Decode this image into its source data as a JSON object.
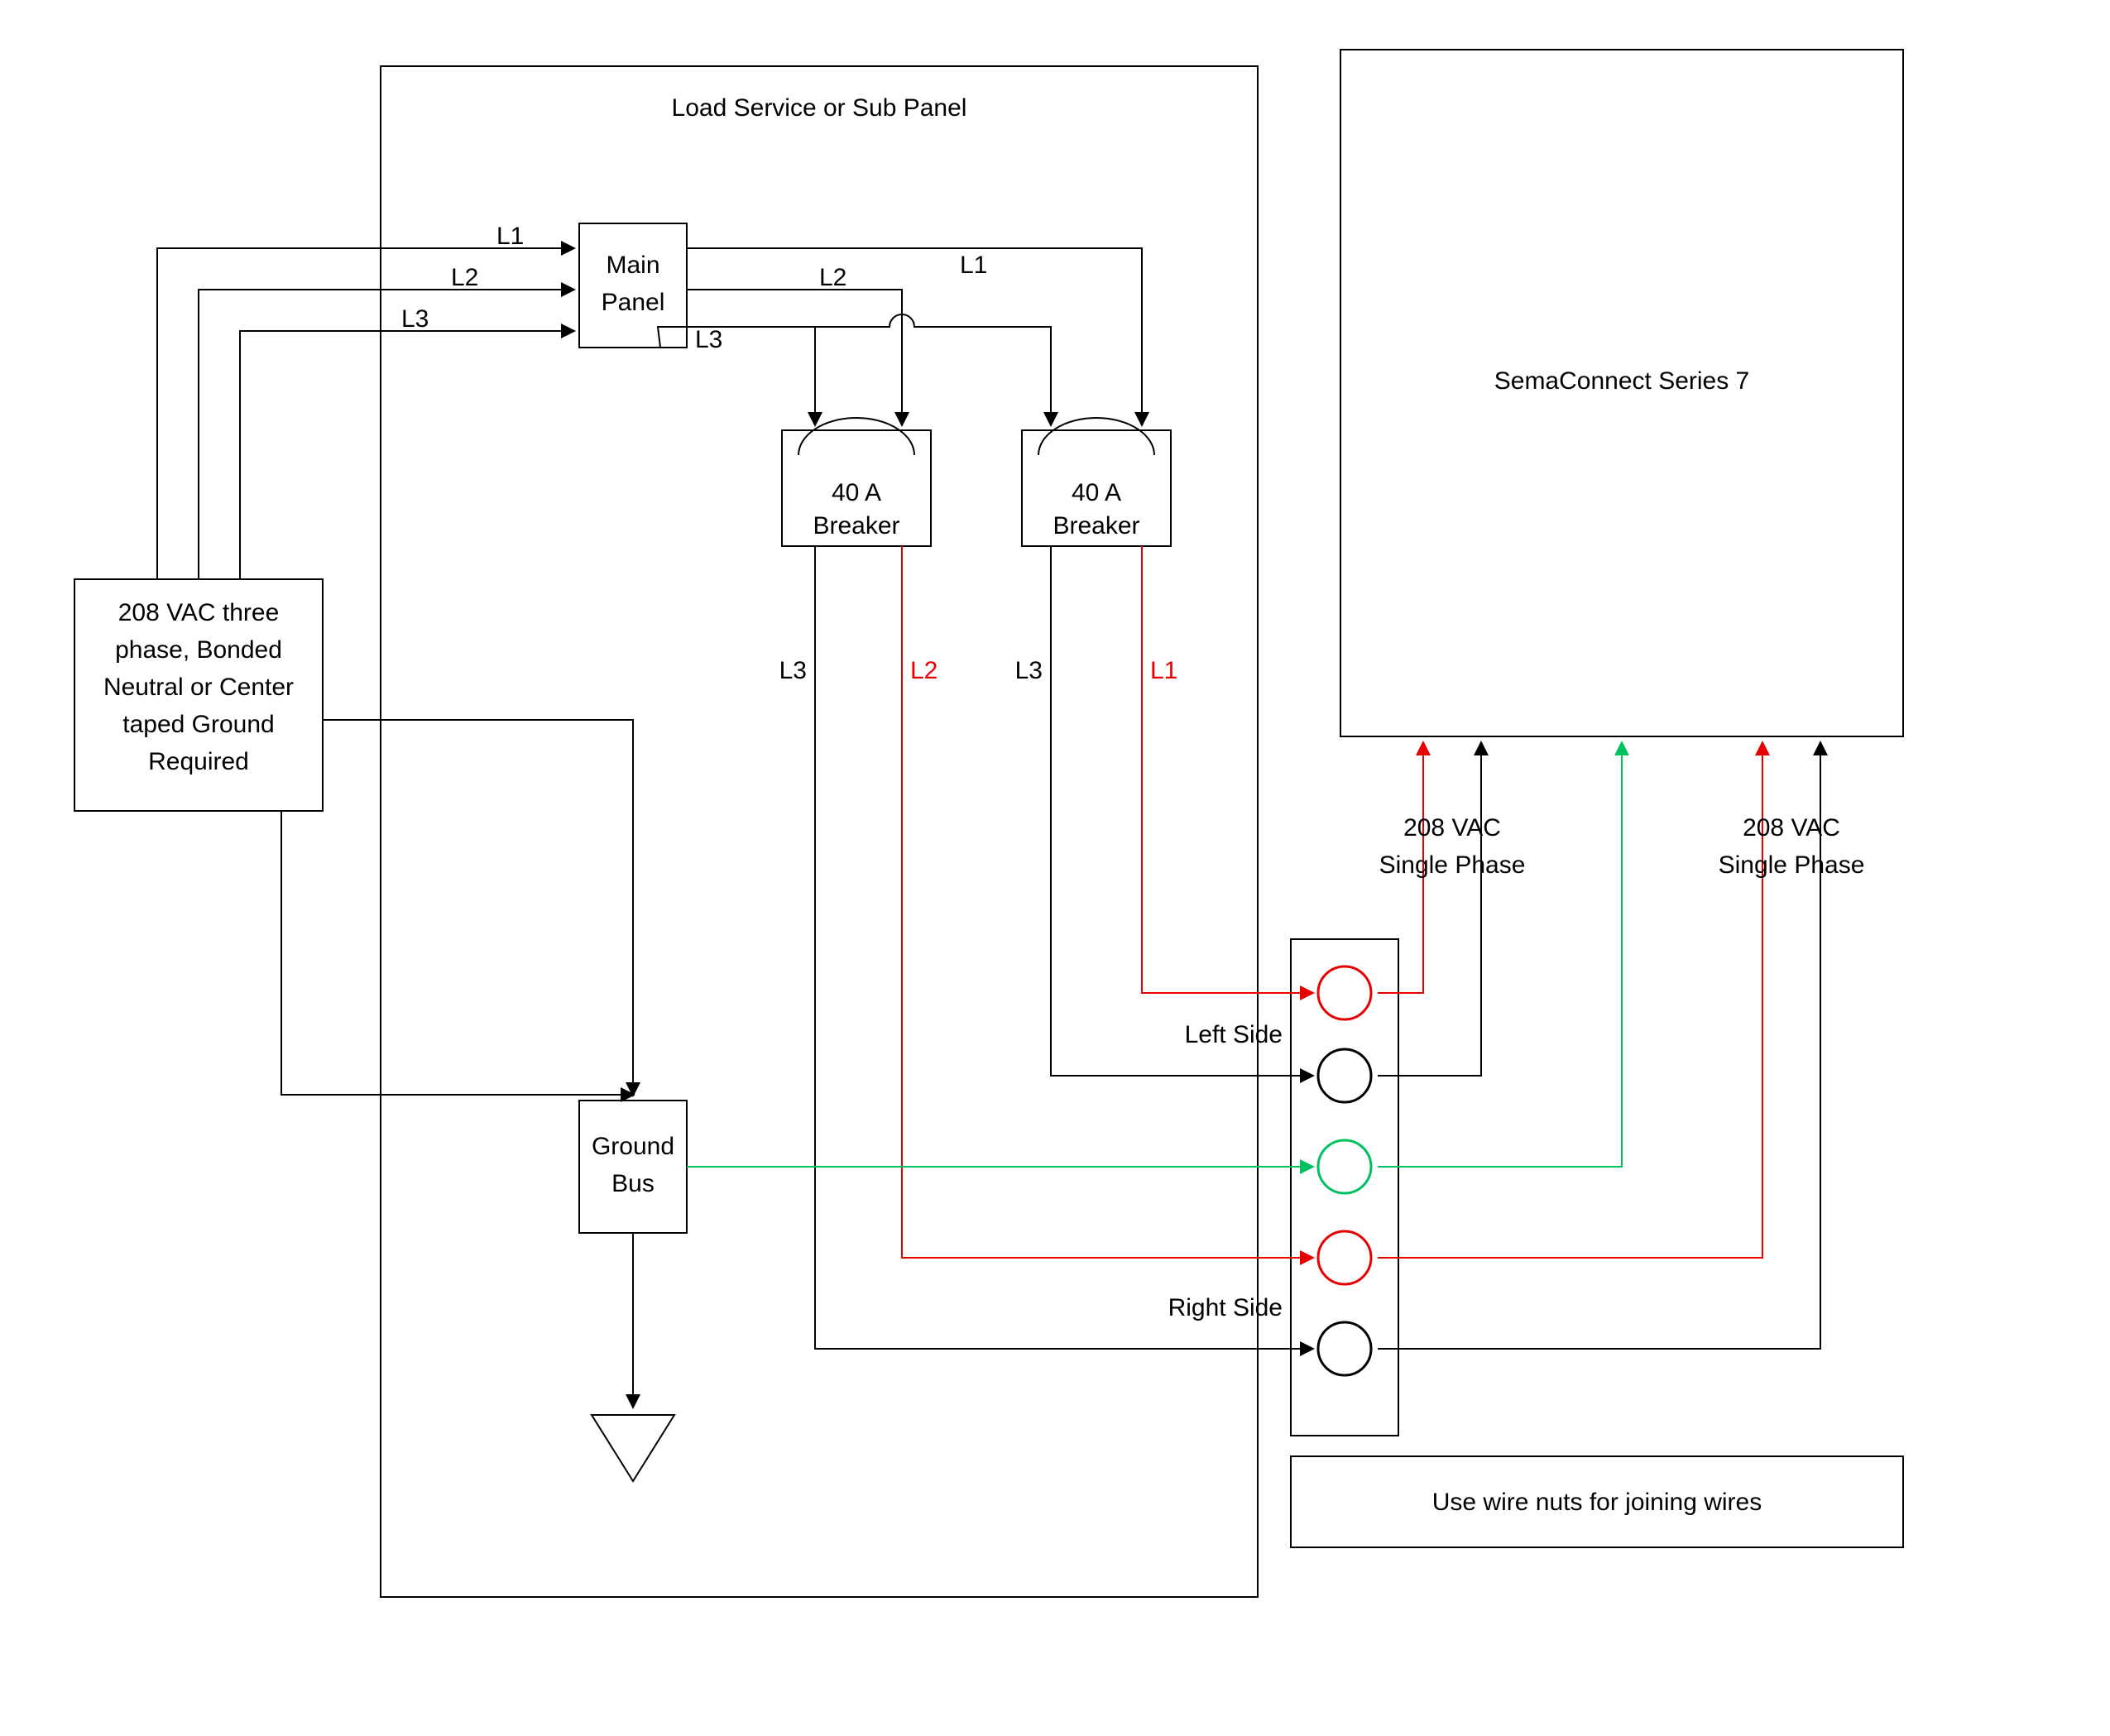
{
  "panel_title": "Load Service or Sub Panel",
  "supply_box": {
    "line1": "208 VAC three",
    "line2": "phase, Bonded",
    "line3": "Neutral or Center",
    "line4": "taped Ground",
    "line5": "Required"
  },
  "main_panel": {
    "line1": "Main",
    "line2": "Panel"
  },
  "breaker": {
    "rating": "40 A",
    "label": "Breaker"
  },
  "ground_bus": {
    "line1": "Ground",
    "line2": "Bus"
  },
  "phases": {
    "l1": "L1",
    "l2": "L2",
    "l3": "L3"
  },
  "sides": {
    "left": "Left Side",
    "right": "Right Side"
  },
  "station": {
    "title": "SemaConnect Series 7"
  },
  "feed": {
    "label": "208 VAC",
    "sub": "Single Phase"
  },
  "note": "Use wire nuts for joining wires",
  "colors": {
    "red": "#e60000",
    "green": "#00c060",
    "black": "#000000"
  }
}
